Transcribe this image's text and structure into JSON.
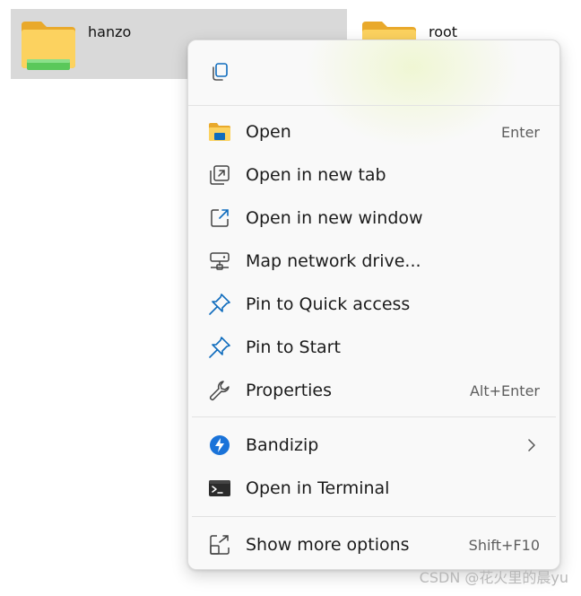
{
  "folders": [
    {
      "name": "hanzo",
      "selected": true
    },
    {
      "name": "root",
      "selected": false
    }
  ],
  "menu": {
    "top_actions": [
      {
        "icon": "copy-icon",
        "label": ""
      }
    ],
    "group1": [
      {
        "label": "Open",
        "shortcut": "Enter",
        "icon": "folder-open-icon"
      },
      {
        "label": "Open in new tab",
        "shortcut": "",
        "icon": "new-tab-icon"
      },
      {
        "label": "Open in new window",
        "shortcut": "",
        "icon": "new-window-icon"
      },
      {
        "label": "Map network drive...",
        "shortcut": "",
        "icon": "network-drive-icon"
      },
      {
        "label": "Pin to Quick access",
        "shortcut": "",
        "icon": "pin-icon"
      },
      {
        "label": "Pin to Start",
        "shortcut": "",
        "icon": "pin-icon"
      },
      {
        "label": "Properties",
        "shortcut": "Alt+Enter",
        "icon": "wrench-icon"
      }
    ],
    "group2": [
      {
        "label": "Bandizip",
        "shortcut": "",
        "icon": "bandizip-icon",
        "submenu": true
      },
      {
        "label": "Open in Terminal",
        "shortcut": "",
        "icon": "terminal-icon"
      }
    ],
    "group3": [
      {
        "label": "Show more options",
        "shortcut": "Shift+F10",
        "icon": "more-options-icon"
      }
    ]
  },
  "watermark": "CSDN @花火里的晨yu",
  "colors": {
    "accent_blue": "#0f6cbd",
    "folder_yellow": "#f8c33c",
    "selection_bg": "#d9d9d9",
    "menu_bg": "#f9f9f9"
  }
}
